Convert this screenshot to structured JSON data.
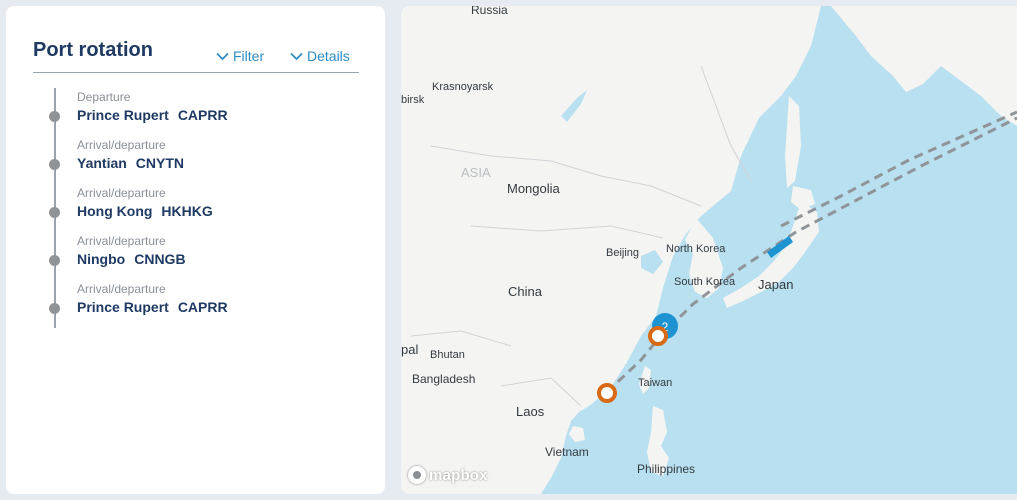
{
  "panel": {
    "title": "Port rotation",
    "filter_label": "Filter",
    "details_label": "Details",
    "stops": [
      {
        "type": "Departure",
        "name": "Prince Rupert",
        "code": "CAPRR"
      },
      {
        "type": "Arrival/departure",
        "name": "Yantian",
        "code": "CNYTN"
      },
      {
        "type": "Arrival/departure",
        "name": "Hong Kong",
        "code": "HKHKG"
      },
      {
        "type": "Arrival/departure",
        "name": "Ningbo",
        "code": "CNNGB"
      },
      {
        "type": "Arrival/departure",
        "name": "Prince Rupert",
        "code": "CAPRR"
      }
    ]
  },
  "map": {
    "labels": {
      "russia": "Russia",
      "krasnoyarsk": "Krasnoyarsk",
      "birsk": "birsk",
      "asia": "ASIA",
      "mongolia": "Mongolia",
      "beijing": "Beijing",
      "north_korea": "North Korea",
      "south_korea": "South Korea",
      "japan": "Japan",
      "china": "China",
      "nepal": "pal",
      "bhutan": "Bhutan",
      "bangladesh": "Bangladesh",
      "taiwan": "Taiwan",
      "laos": "Laos",
      "vietnam": "Vietnam",
      "philippines": "Philippines"
    },
    "cluster_count": "2",
    "attribution": "mapbox",
    "colors": {
      "water": "#b9e0f0",
      "land": "#f4f4f2",
      "port_marker": "#d86a16",
      "cluster": "#1e93d1",
      "vessel": "#1e93d1",
      "route": "#8f9499"
    }
  }
}
